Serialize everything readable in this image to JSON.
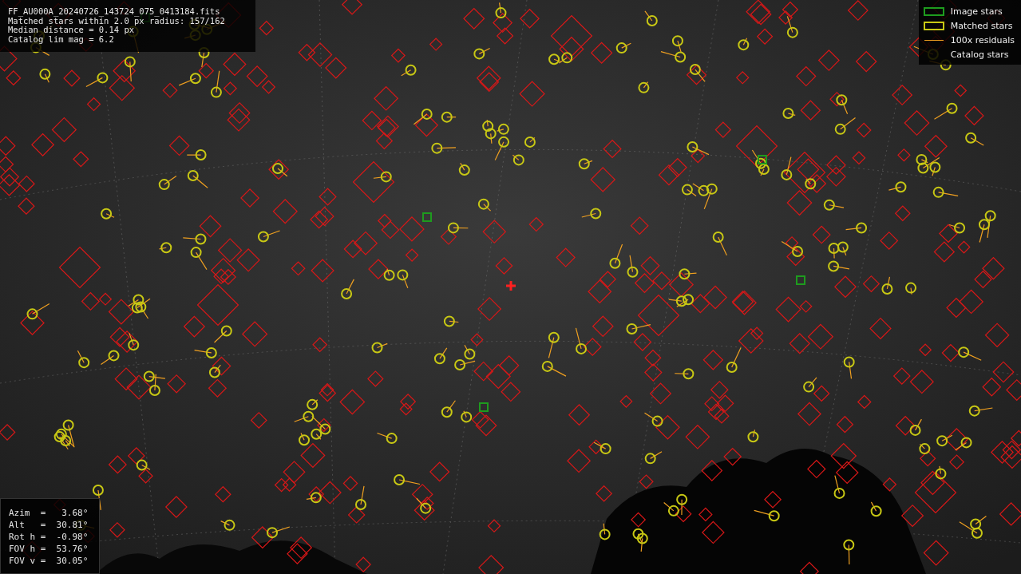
{
  "info": {
    "lines": [
      "FF_AU000A_20240726_143724_075_0413184.fits",
      "Matched stars within 2.0 px radius: 157/162",
      "Median distance = 0.14 px",
      "Catalog lim mag = 6.2"
    ]
  },
  "legend": [
    {
      "kind": "box",
      "label": "Image stars",
      "color": "#1e9b1e"
    },
    {
      "kind": "box",
      "label": "Matched stars",
      "color": "#c8c814"
    },
    {
      "kind": "line",
      "label": "100x residuals",
      "color": "#f0a020"
    },
    {
      "kind": "none",
      "label": "Catalog stars"
    }
  ],
  "pointing": {
    "lines": [
      "Azim  =   3.68°",
      "Alt   =  30.81°",
      "Rot h =  -0.98°",
      "FOV h =  53.76°",
      "FOV v =  30.05°"
    ]
  }
}
